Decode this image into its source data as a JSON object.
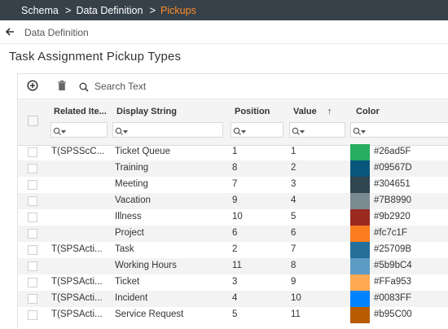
{
  "breadcrumb": {
    "items": [
      "Schema",
      "Data Definition",
      "Pickups"
    ],
    "separator": ">"
  },
  "back": {
    "label": "Data Definition"
  },
  "page_title": "Task Assignment Pickup Types",
  "toolbar": {
    "search_placeholder": "Search Text"
  },
  "columns": {
    "related": "Related Ite...",
    "display": "Display String",
    "position": "Position",
    "value": "Value",
    "value_sort": "↑",
    "color": "Color"
  },
  "rows": [
    {
      "related": "T(SPSScC...",
      "display": "Ticket Queue",
      "position": "1",
      "value": "1",
      "color": "#26ad5F"
    },
    {
      "related": "",
      "display": "Training",
      "position": "8",
      "value": "2",
      "color": "#09567D"
    },
    {
      "related": "",
      "display": "Meeting",
      "position": "7",
      "value": "3",
      "color": "#304651"
    },
    {
      "related": "",
      "display": "Vacation",
      "position": "9",
      "value": "4",
      "color": "#7B8990"
    },
    {
      "related": "",
      "display": "Illness",
      "position": "10",
      "value": "5",
      "color": "#9b2920"
    },
    {
      "related": "",
      "display": "Project",
      "position": "6",
      "value": "6",
      "color": "#fc7c1F"
    },
    {
      "related": "T(SPSActi...",
      "display": "Task",
      "position": "2",
      "value": "7",
      "color": "#25709B"
    },
    {
      "related": "",
      "display": "Working Hours",
      "position": "11",
      "value": "8",
      "color": "#5b9bC4"
    },
    {
      "related": "T(SPSActi...",
      "display": "Ticket",
      "position": "3",
      "value": "9",
      "color": "#FFa953"
    },
    {
      "related": "T(SPSActi...",
      "display": "Incident",
      "position": "4",
      "value": "10",
      "color": "#0083FF"
    },
    {
      "related": "T(SPSActi...",
      "display": "Service Request",
      "position": "5",
      "value": "11",
      "color": "#b95C00"
    }
  ],
  "colors": {
    "topbar": "#36414a",
    "active_crumb": "#ff8c2a"
  }
}
